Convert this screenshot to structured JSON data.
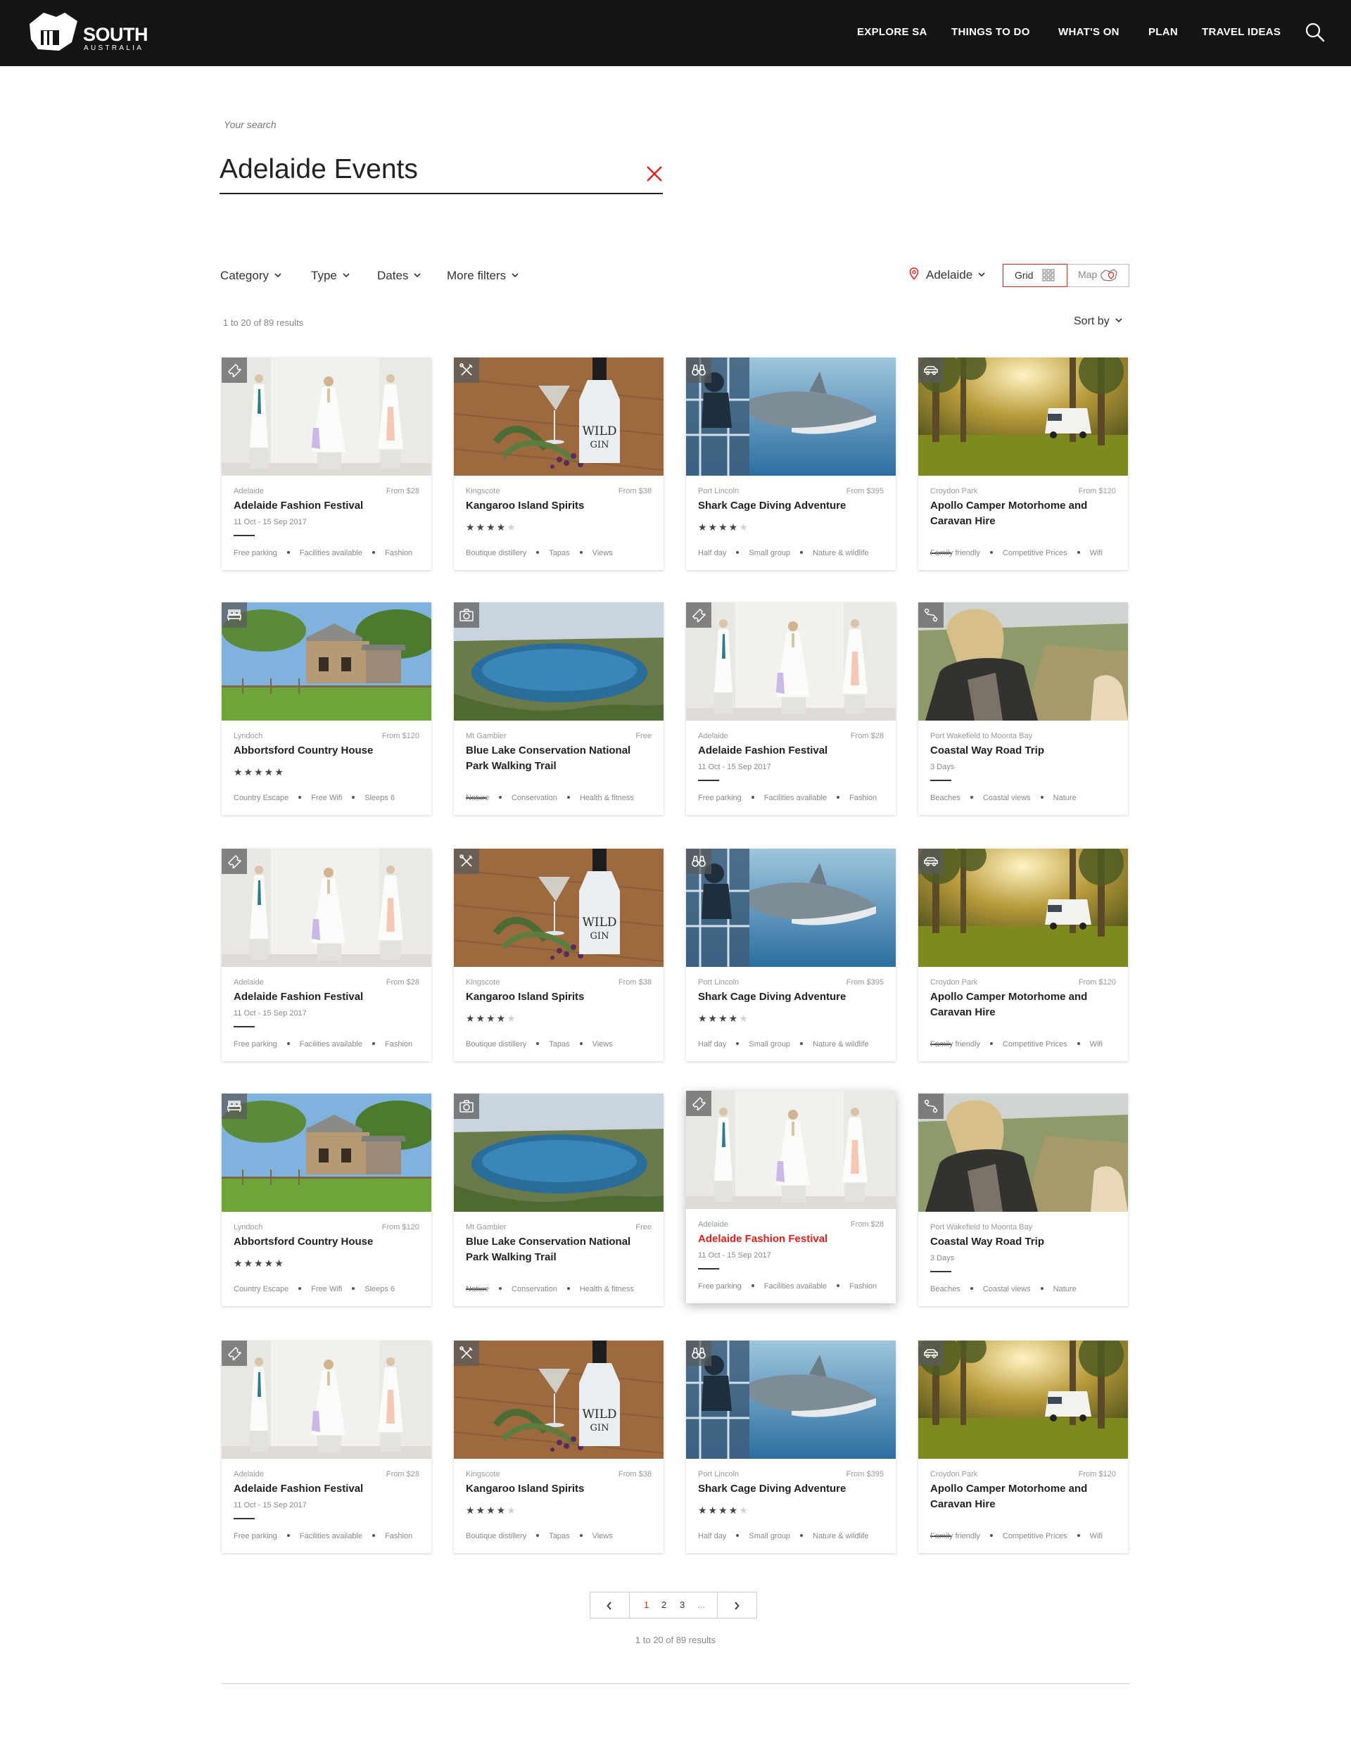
{
  "brand": {
    "name": "SOUTH",
    "sub": "AUSTRALIA"
  },
  "nav": [
    "EXPLORE SA",
    "THINGS TO DO",
    "WHAT'S ON",
    "PLAN",
    "TRAVEL IDEAS"
  ],
  "search": {
    "label": "Your search",
    "value": "Adelaide Events"
  },
  "filters": [
    "Category",
    "Type",
    "Dates",
    "More filters"
  ],
  "location": "Adelaide",
  "view": {
    "grid": "Grid",
    "map": "Map",
    "active": "grid"
  },
  "results_text": "1 to 20 of 89 results",
  "sort_label": "Sort by",
  "accent_color": "#e0211d",
  "cards": [
    {
      "icon": "ticket-icon",
      "image": "fashion",
      "location": "Adelaide",
      "price": "From $28",
      "title": "Adelaide Fashion Festival",
      "date": "11 Oct - 15 Sep 2017",
      "tags": [
        "Free parking",
        "Facilities available",
        "Fashion"
      ]
    },
    {
      "icon": "tools-icon",
      "image": "gin",
      "location": "Kingscote",
      "price": "From $38",
      "title": "Kangaroo Island Spirits",
      "rating": 4,
      "tags": [
        "Boutique distillery",
        "Tapas",
        "Views"
      ]
    },
    {
      "icon": "binoculars-icon",
      "image": "shark",
      "location": "Port Lincoln",
      "price": "From $395",
      "title": "Shark Cage Diving Adventure",
      "rating": 4,
      "tags": [
        "Half day",
        "Small group",
        "Nature & wildlife"
      ]
    },
    {
      "icon": "car-icon",
      "image": "camper",
      "location": "Croydon Park",
      "price": "From $120",
      "title": "Apollo Camper Motorhome and Caravan Hire",
      "tags": [
        "Family friendly",
        "Competitive Prices",
        "Wifi"
      ]
    },
    {
      "icon": "bed-icon",
      "image": "house",
      "location": "Lyndoch",
      "price": "From $120",
      "title": "Abbortsford Country House",
      "rating": 5,
      "tags": [
        "Country Escape",
        "Free Wifi",
        "Sleeps 6"
      ]
    },
    {
      "icon": "camera-icon",
      "image": "lake",
      "location": "Mt Gambier",
      "price": "Free",
      "title": "Blue Lake Conservation National Park Walking Trail",
      "tags": [
        "Nature",
        "Conservation",
        "Health & fitness"
      ]
    },
    {
      "icon": "ticket-icon",
      "image": "fashion",
      "location": "Adelaide",
      "price": "From $28",
      "title": "Adelaide Fashion Festival",
      "date": "11 Oct - 15 Sep 2017",
      "tags": [
        "Free parking",
        "Facilities available",
        "Fashion"
      ]
    },
    {
      "icon": "route-icon",
      "image": "roadtrip",
      "location": "Port Wakefield to Moonta Bay",
      "price": "",
      "title": "Coastal Way Road Trip",
      "date": "3 Days",
      "tags": [
        "Beaches",
        "Coastal views",
        "Nature"
      ]
    },
    {
      "icon": "ticket-icon",
      "image": "fashion",
      "location": "Adelaide",
      "price": "From $28",
      "title": "Adelaide Fashion Festival",
      "date": "11 Oct - 15 Sep 2017",
      "tags": [
        "Free parking",
        "Facilities available",
        "Fashion"
      ]
    },
    {
      "icon": "tools-icon",
      "image": "gin",
      "location": "Kingscote",
      "price": "From $38",
      "title": "Kangaroo Island Spirits",
      "rating": 4,
      "tags": [
        "Boutique distillery",
        "Tapas",
        "Views"
      ]
    },
    {
      "icon": "binoculars-icon",
      "image": "shark",
      "location": "Port Lincoln",
      "price": "From $395",
      "title": "Shark Cage Diving Adventure",
      "rating": 4,
      "tags": [
        "Half day",
        "Small group",
        "Nature & wildlife"
      ]
    },
    {
      "icon": "car-icon",
      "image": "camper",
      "location": "Croydon Park",
      "price": "From $120",
      "title": "Apollo Camper Motorhome and Caravan Hire",
      "tags": [
        "Family friendly",
        "Competitive Prices",
        "Wifi"
      ]
    },
    {
      "icon": "bed-icon",
      "image": "house",
      "location": "Lyndoch",
      "price": "From $120",
      "title": "Abbortsford Country House",
      "rating": 5,
      "tags": [
        "Country Escape",
        "Free Wifi",
        "Sleeps 6"
      ]
    },
    {
      "icon": "camera-icon",
      "image": "lake",
      "location": "Mt Gambier",
      "price": "Free",
      "title": "Blue Lake Conservation National Park Walking Trail",
      "tags": [
        "Nature",
        "Conservation",
        "Health & fitness"
      ]
    },
    {
      "icon": "ticket-icon",
      "image": "fashion",
      "location": "Adelaide",
      "price": "From $28",
      "title": "Adelaide Fashion Festival",
      "date": "11 Oct - 15 Sep 2017",
      "tags": [
        "Free parking",
        "Facilities available",
        "Fashion"
      ],
      "highlight": true
    },
    {
      "icon": "route-icon",
      "image": "roadtrip",
      "location": "Port Wakefield to Moonta Bay",
      "price": "",
      "title": "Coastal Way Road Trip",
      "date": "3 Days",
      "tags": [
        "Beaches",
        "Coastal views",
        "Nature"
      ]
    },
    {
      "icon": "ticket-icon",
      "image": "fashion",
      "location": "Adelaide",
      "price": "From $28",
      "title": "Adelaide Fashion Festival",
      "date": "11 Oct - 15 Sep 2017",
      "tags": [
        "Free parking",
        "Facilities available",
        "Fashion"
      ]
    },
    {
      "icon": "tools-icon",
      "image": "gin",
      "location": "Kingscote",
      "price": "From $38",
      "title": "Kangaroo Island Spirits",
      "rating": 4,
      "tags": [
        "Boutique distillery",
        "Tapas",
        "Views"
      ]
    },
    {
      "icon": "binoculars-icon",
      "image": "shark",
      "location": "Port Lincoln",
      "price": "From $395",
      "title": "Shark Cage Diving Adventure",
      "rating": 4,
      "tags": [
        "Half day",
        "Small group",
        "Nature & wildlife"
      ]
    },
    {
      "icon": "car-icon",
      "image": "camper",
      "location": "Croydon Park",
      "price": "From $120",
      "title": "Apollo Camper Motorhome and Caravan Hire",
      "tags": [
        "Family friendly",
        "Competitive Prices",
        "Wifi"
      ]
    }
  ],
  "pagination": {
    "pages": [
      "1",
      "2",
      "3",
      "..."
    ],
    "current": "1"
  }
}
